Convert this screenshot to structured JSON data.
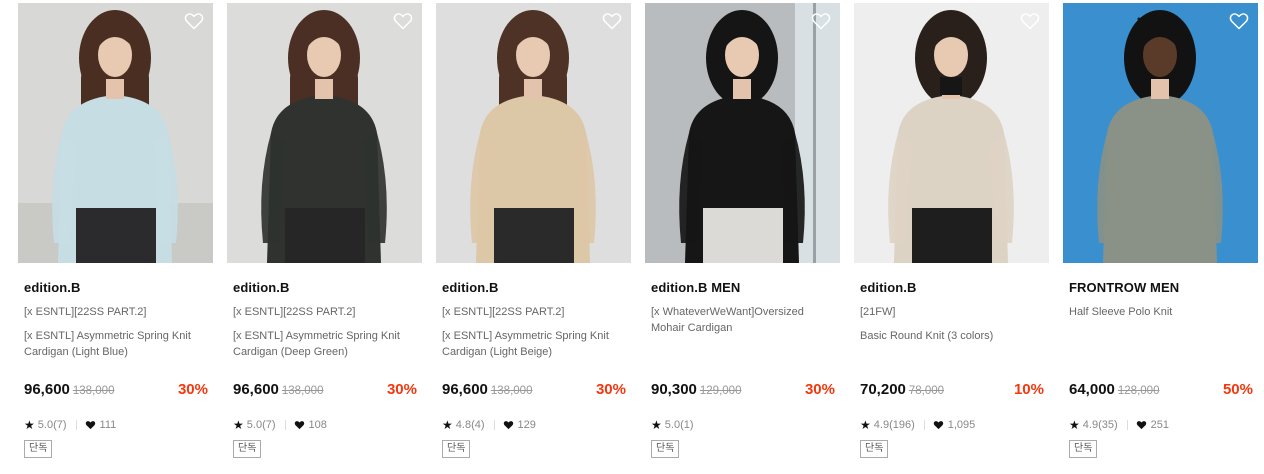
{
  "products": [
    {
      "brand": "edition.B",
      "subtitle": "[x ESNTL][22SS PART.2]",
      "name": "[x ESNTL] Asymmetric Spring Knit Cardigan (Light Blue)",
      "price": "96,600",
      "original_price": "138,000",
      "discount": "30%",
      "rating": "5.0",
      "review_count": "(7)",
      "likes": "111",
      "tag": "단독",
      "image": "model-in-light-blue-cardigan",
      "colors": {
        "bg": "#d8d8d6",
        "garment": "#c6dde4",
        "pants": "#2b2b2e",
        "hair": "#4a2e22"
      }
    },
    {
      "brand": "edition.B",
      "subtitle": "[x ESNTL][22SS PART.2]",
      "name": "[x ESNTL] Asymmetric Spring Knit Cardigan (Deep Green)",
      "price": "96,600",
      "original_price": "138,000",
      "discount": "30%",
      "rating": "5.0",
      "review_count": "(7)",
      "likes": "108",
      "tag": "단독",
      "image": "model-in-deep-green-cardigan",
      "colors": {
        "bg": "#dcdcda",
        "garment": "#2f322f",
        "pants": "#262626",
        "hair": "#4b2f24"
      }
    },
    {
      "brand": "edition.B",
      "subtitle": "[x ESNTL][22SS PART.2]",
      "name": "[x ESNTL] Asymmetric Spring Knit Cardigan (Light Beige)",
      "price": "96,600",
      "original_price": "138,000",
      "discount": "30%",
      "rating": "4.8",
      "review_count": "(4)",
      "likes": "129",
      "tag": "단독",
      "image": "model-in-light-beige-cardigan",
      "colors": {
        "bg": "#dedede",
        "garment": "#dcc7a6",
        "pants": "#2a2a2a",
        "hair": "#4e3226"
      }
    },
    {
      "brand": "edition.B MEN",
      "subtitle": "",
      "name": "[x WhateverWeWant]Oversized Mohair Cardigan",
      "price": "90,300",
      "original_price": "129,000",
      "discount": "30%",
      "rating": "5.0",
      "review_count": "(1)",
      "likes": "",
      "tag": "단독",
      "image": "male-model-in-black-mohair-cardigan",
      "colors": {
        "bg": "#b9bcbe",
        "garment": "#161616",
        "pants": "#dcdad6",
        "hair": "#151515"
      }
    },
    {
      "brand": "edition.B",
      "subtitle": "[21FW]",
      "name": "Basic Round Knit (3 colors)",
      "price": "70,200",
      "original_price": "78,000",
      "discount": "10%",
      "rating": "4.9",
      "review_count": "(196)",
      "likes": "1,095",
      "tag": "단독",
      "image": "model-in-oatmeal-round-knit",
      "colors": {
        "bg": "#eeeeee",
        "garment": "#ddd3c4",
        "pants": "#1e1e1e",
        "hair": "#2a201b"
      }
    },
    {
      "brand": "FRONTROW MEN",
      "subtitle": "",
      "name": "Half Sleeve Polo Knit",
      "price": "64,000",
      "original_price": "128,000",
      "discount": "50%",
      "rating": "4.9",
      "review_count": "(35)",
      "likes": "251",
      "tag": "단독",
      "image": "male-model-in-grey-polo-knit",
      "colors": {
        "bg": "#3a8fcf",
        "garment": "#8a9187",
        "pants": "#8a9187",
        "hair": "#121212"
      }
    }
  ]
}
